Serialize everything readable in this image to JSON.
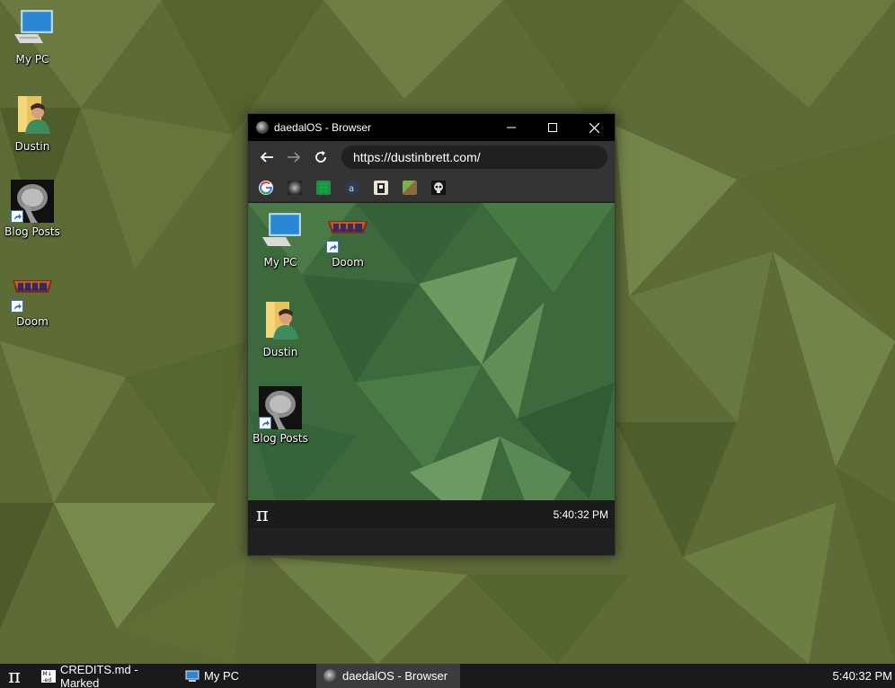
{
  "desktop": {
    "icons": [
      {
        "label": "My PC"
      },
      {
        "label": "Dustin"
      },
      {
        "label": "Blog Posts"
      },
      {
        "label": "Doom"
      }
    ]
  },
  "window": {
    "title": "daedalOS - Browser",
    "url": "https://dustinbrett.com/",
    "bookmarks": [
      "google-icon",
      "blog-posts-icon",
      "spreadsheet-icon",
      "archive-icon",
      "game-icon",
      "minecraft-icon",
      "skull-icon"
    ],
    "inner_desktop": {
      "icons": [
        {
          "label": "My PC"
        },
        {
          "label": "Doom"
        },
        {
          "label": "Dustin"
        },
        {
          "label": "Blog Posts"
        }
      ]
    },
    "inner_taskbar": {
      "start": "π",
      "clock": "5:40:32 PM"
    }
  },
  "taskbar": {
    "start": "π",
    "items": [
      {
        "label": "CREDITS.md - Marked",
        "active": false
      },
      {
        "label": "My PC",
        "active": false
      },
      {
        "label": "daedalOS - Browser",
        "active": true
      }
    ],
    "clock": "5:40:32 PM"
  },
  "colors": {
    "wallpaper": "#5d6b37",
    "inner_wallpaper": "#3c6a3c",
    "taskbar": "#1a1a1a",
    "titlebar": "#000000"
  }
}
